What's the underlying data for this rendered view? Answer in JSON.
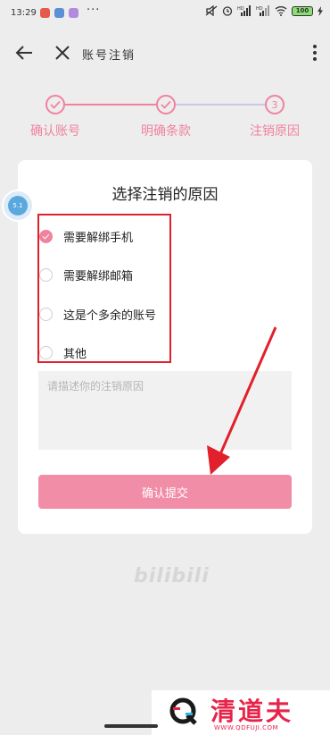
{
  "status_bar": {
    "time": "13:29",
    "more": "···",
    "network": "HD",
    "battery": "100"
  },
  "navbar": {
    "title": "账号注销"
  },
  "steps": [
    {
      "label": "确认账号",
      "state": "done"
    },
    {
      "label": "明确条款",
      "state": "done"
    },
    {
      "label": "注销原因",
      "state": "current",
      "number": "3"
    }
  ],
  "card": {
    "title": "选择注销的原因",
    "options": [
      {
        "label": "需要解绑手机",
        "checked": true
      },
      {
        "label": "需要解绑邮箱",
        "checked": false
      },
      {
        "label": "这是个多余的账号",
        "checked": false
      },
      {
        "label": "其他",
        "checked": false
      }
    ],
    "textarea_placeholder": "请描述你的注销原因",
    "textarea_value": "",
    "submit_label": "确认提交"
  },
  "float_bubble": {
    "text": "5.1"
  },
  "brand_logo": "bilibili",
  "watermark": {
    "title": "清道夫",
    "url": "WWW.QDFUJI.COM"
  },
  "colors": {
    "accent": "#f0829f",
    "submit": "#f28da8",
    "highlight": "#e1202b",
    "watermark": "#e8234a"
  }
}
